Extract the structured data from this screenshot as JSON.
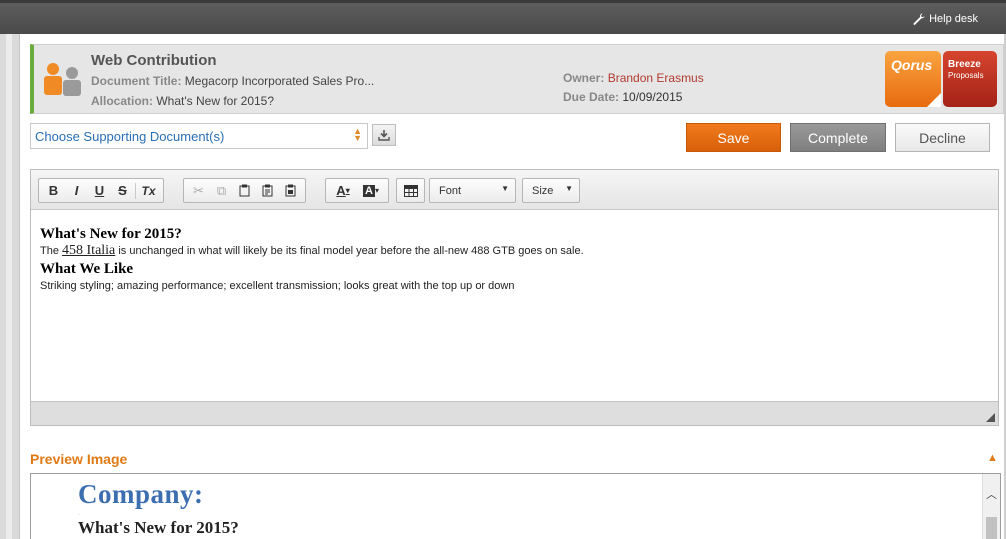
{
  "topbar": {
    "help_label": "Help desk"
  },
  "header": {
    "title": "Web Contribution",
    "document_title_label": "Document Title:",
    "document_title_value": "Megacorp Incorporated Sales Pro...",
    "allocation_label": "Allocation:",
    "allocation_value": "What's New for 2015?",
    "owner_label": "Owner:",
    "owner_value": "Brandon Erasmus",
    "due_label": "Due Date:",
    "due_value": "10/09/2015",
    "logo_left": "Qorus",
    "logo_right_top": "Breeze",
    "logo_right_bottom": "Proposals"
  },
  "supporting": {
    "select_label": "Choose Supporting Document(s)"
  },
  "actions": {
    "save": "Save",
    "complete": "Complete",
    "decline": "Decline"
  },
  "toolbar": {
    "bold": "B",
    "italic": "I",
    "underline": "U",
    "strike": "S",
    "clear_format": "Tx",
    "font_color": "A",
    "bg_color": "A",
    "font_combo": "Font",
    "size_combo": "Size"
  },
  "content": {
    "heading1": "What's New for 2015?",
    "para1_prefix": "The ",
    "para1_link": "458 Italia",
    "para1_suffix": " is unchanged in what will likely be its final model year before the all-new 488 GTB goes on sale.",
    "heading2": "What We Like",
    "para2": "Striking styling; amazing performance; excellent transmission; looks great with the top up or down"
  },
  "preview": {
    "title": "Preview Image",
    "company": "Company:",
    "heading": "What's New for 2015?"
  },
  "colors": {
    "accent_orange": "#e07a16",
    "save_orange": "#e86d12",
    "owner_red": "#b23a2f",
    "link_blue": "#2a6fb5",
    "header_green": "#6aad3c"
  }
}
